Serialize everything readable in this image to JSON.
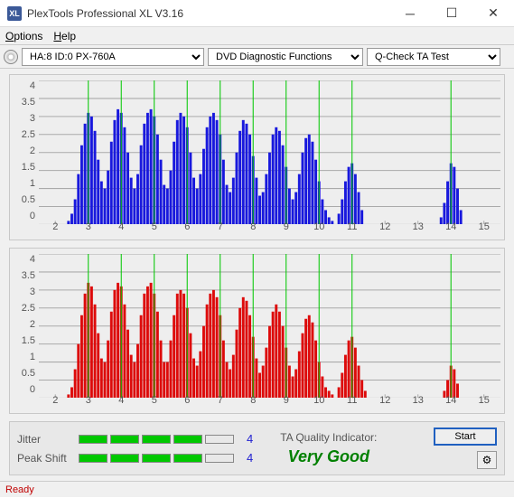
{
  "title": "PlexTools Professional XL V3.16",
  "menu": {
    "options": "Options",
    "help": "Help"
  },
  "toolbar": {
    "drive": "HA:8 ID:0   PX-760A",
    "mode": "DVD Diagnostic Functions",
    "test": "Q-Check TA Test"
  },
  "chart_data": [
    {
      "type": "bar",
      "color": "#1818dd",
      "xlabel": "",
      "ylabel": "",
      "ylim": [
        0,
        4
      ],
      "yticks": [
        0,
        0.5,
        1,
        1.5,
        2,
        2.5,
        3,
        3.5,
        4
      ],
      "xticks": [
        2,
        3,
        4,
        5,
        6,
        7,
        8,
        9,
        10,
        11,
        12,
        13,
        14,
        15
      ],
      "grid_x": [
        3,
        4,
        5,
        6,
        7,
        8,
        9,
        10,
        11,
        14
      ],
      "series": [
        {
          "x": [
            2.4,
            2.5,
            2.6,
            2.7,
            2.8,
            2.9,
            3.0,
            3.1,
            3.2,
            3.3,
            3.4,
            3.5,
            3.6,
            3.7,
            3.8,
            3.9,
            4.0,
            4.1,
            4.2,
            4.3,
            4.4,
            4.5,
            4.6,
            4.7,
            4.8,
            4.9,
            5.0,
            5.1,
            5.2,
            5.3,
            5.4,
            5.5,
            5.6,
            5.7,
            5.8,
            5.9,
            6.0,
            6.1,
            6.2,
            6.3,
            6.4,
            6.5,
            6.6,
            6.7,
            6.8,
            6.9,
            7.0,
            7.1,
            7.2,
            7.3,
            7.4,
            7.5,
            7.6,
            7.7,
            7.8,
            7.9,
            8.0,
            8.1,
            8.2,
            8.3,
            8.4,
            8.5,
            8.6,
            8.7,
            8.8,
            8.9,
            9.0,
            9.1,
            9.2,
            9.3,
            9.4,
            9.5,
            9.6,
            9.7,
            9.8,
            9.9,
            10.0,
            10.1,
            10.2,
            10.3,
            10.4,
            10.6,
            10.7,
            10.8,
            10.9,
            11.0,
            11.1,
            11.2,
            11.3,
            13.7,
            13.8,
            13.9,
            14.0,
            14.1,
            14.2,
            14.3
          ],
          "y": [
            0.1,
            0.3,
            0.7,
            1.4,
            2.2,
            2.8,
            3.1,
            3.0,
            2.6,
            1.8,
            1.2,
            1.0,
            1.5,
            2.3,
            2.9,
            3.2,
            3.1,
            2.7,
            2.0,
            1.3,
            1.0,
            1.4,
            2.2,
            2.8,
            3.1,
            3.2,
            3.0,
            2.5,
            1.8,
            1.1,
            1.0,
            1.5,
            2.3,
            2.9,
            3.1,
            3.0,
            2.7,
            2.0,
            1.3,
            1.0,
            1.4,
            2.1,
            2.7,
            3.0,
            3.1,
            2.9,
            2.5,
            1.8,
            1.1,
            0.9,
            1.3,
            2.0,
            2.6,
            2.9,
            2.8,
            2.5,
            1.9,
            1.3,
            0.8,
            0.9,
            1.4,
            2.0,
            2.5,
            2.7,
            2.6,
            2.2,
            1.6,
            1.0,
            0.7,
            0.9,
            1.4,
            2.0,
            2.4,
            2.5,
            2.3,
            1.8,
            1.2,
            0.7,
            0.4,
            0.2,
            0.1,
            0.3,
            0.7,
            1.2,
            1.6,
            1.7,
            1.4,
            0.9,
            0.4,
            0.2,
            0.6,
            1.2,
            1.7,
            1.6,
            1.0,
            0.4
          ]
        }
      ]
    },
    {
      "type": "bar",
      "color": "#dd0a0a",
      "xlabel": "",
      "ylabel": "",
      "ylim": [
        0,
        4
      ],
      "yticks": [
        0,
        0.5,
        1,
        1.5,
        2,
        2.5,
        3,
        3.5,
        4
      ],
      "xticks": [
        2,
        3,
        4,
        5,
        6,
        7,
        8,
        9,
        10,
        11,
        12,
        13,
        14,
        15
      ],
      "grid_x": [
        3,
        4,
        5,
        6,
        7,
        8,
        9,
        10,
        11,
        14
      ],
      "series": [
        {
          "x": [
            2.4,
            2.5,
            2.6,
            2.7,
            2.8,
            2.9,
            3.0,
            3.1,
            3.2,
            3.3,
            3.4,
            3.5,
            3.6,
            3.7,
            3.8,
            3.9,
            4.0,
            4.1,
            4.2,
            4.3,
            4.4,
            4.5,
            4.6,
            4.7,
            4.8,
            4.9,
            5.0,
            5.1,
            5.2,
            5.3,
            5.4,
            5.5,
            5.6,
            5.7,
            5.8,
            5.9,
            6.0,
            6.1,
            6.2,
            6.3,
            6.4,
            6.5,
            6.6,
            6.7,
            6.8,
            6.9,
            7.0,
            7.1,
            7.2,
            7.3,
            7.4,
            7.5,
            7.6,
            7.7,
            7.8,
            7.9,
            8.0,
            8.1,
            8.2,
            8.3,
            8.4,
            8.5,
            8.6,
            8.7,
            8.8,
            8.9,
            9.0,
            9.1,
            9.2,
            9.3,
            9.4,
            9.5,
            9.6,
            9.7,
            9.8,
            9.9,
            10.0,
            10.1,
            10.2,
            10.3,
            10.4,
            10.6,
            10.7,
            10.8,
            10.9,
            11.0,
            11.1,
            11.2,
            11.3,
            11.4,
            13.8,
            13.9,
            14.0,
            14.1,
            14.2
          ],
          "y": [
            0.1,
            0.3,
            0.8,
            1.5,
            2.3,
            2.9,
            3.2,
            3.1,
            2.6,
            1.8,
            1.1,
            1.0,
            1.6,
            2.4,
            3.0,
            3.2,
            3.1,
            2.6,
            1.9,
            1.2,
            1.0,
            1.5,
            2.3,
            2.9,
            3.1,
            3.2,
            2.9,
            2.4,
            1.6,
            1.0,
            1.0,
            1.6,
            2.3,
            2.9,
            3.0,
            2.9,
            2.5,
            1.8,
            1.1,
            0.9,
            1.3,
            2.0,
            2.6,
            2.9,
            3.0,
            2.8,
            2.3,
            1.6,
            1.0,
            0.8,
            1.2,
            1.9,
            2.5,
            2.8,
            2.7,
            2.3,
            1.7,
            1.1,
            0.7,
            0.9,
            1.4,
            2.0,
            2.4,
            2.6,
            2.4,
            2.0,
            1.4,
            0.9,
            0.6,
            0.8,
            1.3,
            1.8,
            2.2,
            2.3,
            2.1,
            1.6,
            1.0,
            0.6,
            0.3,
            0.2,
            0.1,
            0.3,
            0.7,
            1.2,
            1.6,
            1.7,
            1.4,
            0.9,
            0.5,
            0.2,
            0.2,
            0.5,
            0.9,
            0.8,
            0.4
          ]
        }
      ]
    }
  ],
  "indicators": {
    "jitter": {
      "label": "Jitter",
      "filled": 4,
      "total": 5,
      "value": "4"
    },
    "peak_shift": {
      "label": "Peak Shift",
      "filled": 4,
      "total": 5,
      "value": "4"
    }
  },
  "quality": {
    "label": "TA Quality Indicator:",
    "value": "Very Good"
  },
  "buttons": {
    "start": "Start"
  },
  "status": "Ready"
}
